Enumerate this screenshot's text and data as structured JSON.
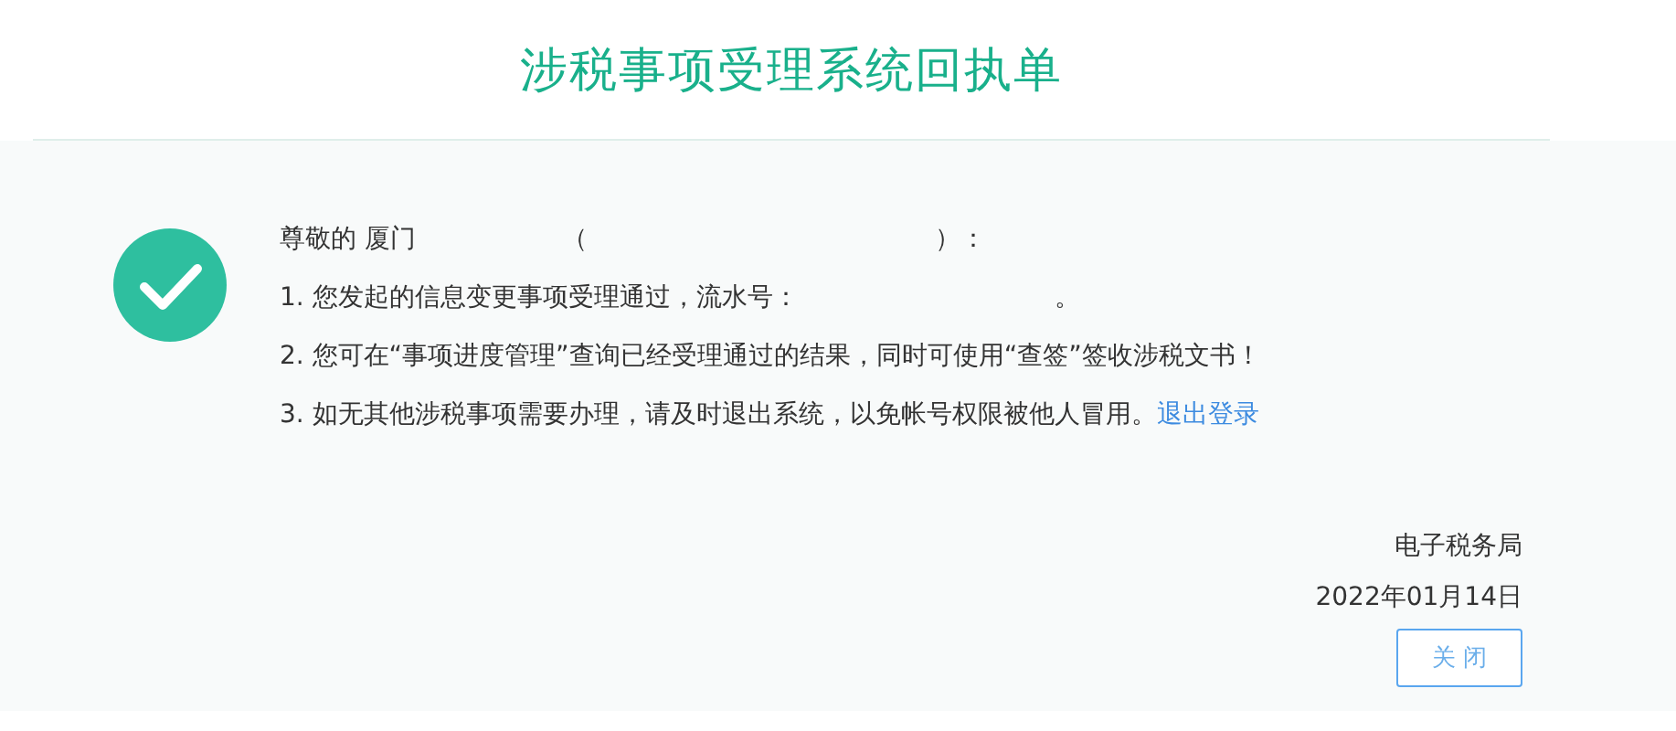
{
  "title": "涉税事项受理系统回执单",
  "greeting": {
    "salutation": "尊敬的 厦门",
    "open_paren": "（",
    "close_paren": "）："
  },
  "line_1": {
    "text": "1. 您发起的信息变更事项受理通过，流水号：",
    "end": "。"
  },
  "line_2": {
    "text": "2. 您可在“事项进度管理”查询已经受理通过的结果，同时可使用“查签”签收涉税文书！"
  },
  "line_3": {
    "text": "3. 如无其他涉税事项需要办理，请及时退出系统，以免帐号权限被他人冒用。",
    "link": "退出登录"
  },
  "signature": {
    "office": "电子税务局",
    "date": "2022年01月14日"
  },
  "close_button": "关 闭"
}
